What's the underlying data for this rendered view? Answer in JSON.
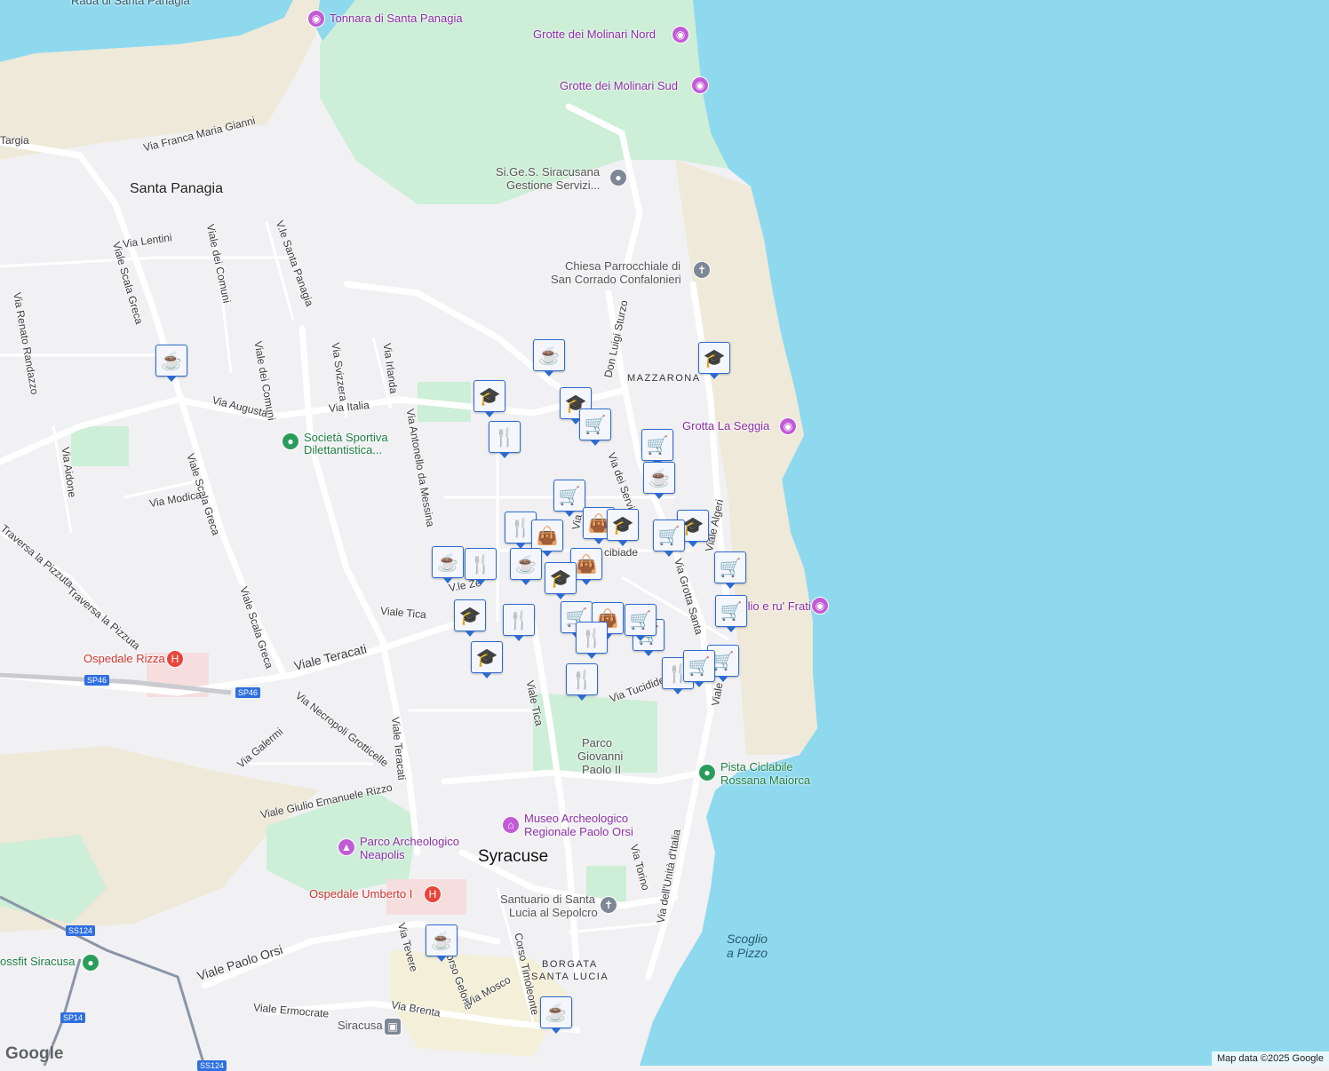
{
  "map": {
    "colors": {
      "water": "#8fd9ee",
      "land": "#f1f1f3",
      "park": "#cdeed7",
      "beige": "#efe9d9",
      "road": "#ffffff",
      "pin_border": "#2d6bd0",
      "pin_icon": "#0e2f5c"
    },
    "labels": {
      "rada": "Rada di Santa Panagia",
      "santa_panagia": "Santa Panagia",
      "mazzarona": "MAZZARONA",
      "syracuse": "Syracuse",
      "borgata1": "BORGATA",
      "borgata2": "SANTA LUCIA",
      "scoglio1": "Scoglio",
      "scoglio2": "a Pizzo"
    },
    "streets": {
      "targia": "Targia",
      "franca": "Via Franca Maria Gianni",
      "lentini": "Via Lentini",
      "comuni1": "Viale dei Comuni",
      "comuni2": "Viale dei Comuni",
      "santa_panagia": "V.le Santa Panagia",
      "scala_greca1": "Viale Scala Greca",
      "scala_greca2": "Viale Scala Greca",
      "scala_greca3": "Viale Scala Greca",
      "randazzo": "Via Renato Randazzo",
      "svizzera": "Via Svizzera",
      "irlanda": "Via Irlanda",
      "italia": "Via Italia",
      "augusta": "Via Augusta",
      "antonello": "Via Antonello da Messina",
      "aidone": "Via Aidone",
      "modica": "Via Modica",
      "pizzuta1": "Traversa la Pizzuta",
      "pizzuta2": "Traversa la Pizzuta",
      "tica1": "Viale Tica",
      "tica2": "Viale Tica",
      "teracati1": "Viale Teracati",
      "teracati2": "Viale Teracati",
      "necropoli": "Via Necropoli Grotticelle",
      "galermi": "Via Galermi",
      "rizzo": "Viale Giulio Emanuele Rizzo",
      "sturzo": "Don Luigi Sturzo",
      "servi": "Via dei Servi",
      "algeri": "Viale Algeri",
      "grotta": "Via Grotta Santa",
      "tucidide": "Via Tucidide",
      "unita": "Via dell'Unità d'Italia",
      "torino": "Via Torino",
      "tevere": "Via Tevere",
      "gelone": "Corso Gelone",
      "timoleonte": "Corso Timoleonte",
      "mosco": "Via Mosco",
      "brenta": "Via Brenta",
      "ermocrate": "Viale Ermocrate",
      "paolo_orsi": "Viale Paolo Orsi",
      "alcibiade": "cibiade",
      "zecchino": "V.le Ze",
      "filisto": "Via Fili",
      "viale": "Viale",
      "sp46a": "SP46",
      "sp46b": "SP46",
      "ss124": "SS124",
      "sp14": "SP14",
      "ss124b": "SS124"
    },
    "pois": {
      "tonnara": "Tonnara di Santa Panagia",
      "molinari_nord": "Grotte dei Molinari Nord",
      "molinari_sud": "Grotte dei Molinari Sud",
      "sigess1": "Si.Ge.S. Siracusana",
      "sigess2": "Gestione Servizi...",
      "chiesa1": "Chiesa Parrocchiale di",
      "chiesa2": "San Corrado Confalonieri",
      "seggia": "Grotta La Seggia",
      "societa1": "Società Sportiva",
      "societa2": "Dilettantistica...",
      "frati": "Scoglio e ru' Frati",
      "rizza": "Ospedale Rizza",
      "parco_gp1": "Parco",
      "parco_gp2": "Giovanni",
      "parco_gp3": "Paolo II",
      "pista1": "Pista Ciclabile",
      "pista2": "Rossana Maiorca",
      "museo1": "Museo Archeologico",
      "museo2": "Regionale Paolo Orsi",
      "neapolis1": "Parco Archeologico",
      "neapolis2": "Neapolis",
      "umberto": "Ospedale Umberto I",
      "santuario1": "Santuario di Santa",
      "santuario2": "Lucia al Sepolcro",
      "crossfit": "ossfit Siracusa",
      "station": "Siracusa"
    },
    "pins": [
      {
        "icon": "coffee-icon",
        "glyph": "☕"
      },
      {
        "icon": "coffee-icon",
        "glyph": "☕"
      },
      {
        "icon": "school-icon",
        "glyph": "🎓"
      },
      {
        "icon": "school-icon",
        "glyph": "🎓"
      },
      {
        "icon": "school-icon",
        "glyph": "🎓"
      },
      {
        "icon": "shopping-cart-icon",
        "glyph": "🛒"
      },
      {
        "icon": "restaurant-icon",
        "glyph": "🍴"
      },
      {
        "icon": "shopping-cart-icon",
        "glyph": "🛒"
      },
      {
        "icon": "coffee-icon",
        "glyph": "☕"
      },
      {
        "icon": "shopping-cart-icon",
        "glyph": "🛒"
      },
      {
        "icon": "restaurant-icon",
        "glyph": "🍴"
      },
      {
        "icon": "shopping-bag-icon",
        "glyph": "👜"
      },
      {
        "icon": "shopping-bag-icon",
        "glyph": "👜"
      },
      {
        "icon": "school-icon",
        "glyph": "🎓"
      },
      {
        "icon": "school-icon",
        "glyph": "🎓"
      },
      {
        "icon": "shopping-cart-icon",
        "glyph": "🛒"
      },
      {
        "icon": "coffee-icon",
        "glyph": "☕"
      },
      {
        "icon": "restaurant-icon",
        "glyph": "🍴"
      },
      {
        "icon": "coffee-icon",
        "glyph": "☕"
      },
      {
        "icon": "shopping-bag-icon",
        "glyph": "👜"
      },
      {
        "icon": "school-icon",
        "glyph": "🎓"
      },
      {
        "icon": "shopping-cart-icon",
        "glyph": "🛒"
      },
      {
        "icon": "shopping-cart-icon",
        "glyph": "🛒"
      },
      {
        "icon": "school-icon",
        "glyph": "🎓"
      },
      {
        "icon": "restaurant-icon",
        "glyph": "🍴"
      },
      {
        "icon": "school-icon",
        "glyph": "🎓"
      },
      {
        "icon": "shopping-cart-icon",
        "glyph": "🛒"
      },
      {
        "icon": "shopping-bag-icon",
        "glyph": "👜"
      },
      {
        "icon": "shopping-cart-icon",
        "glyph": "🛒"
      },
      {
        "icon": "restaurant-icon",
        "glyph": "🍴"
      },
      {
        "icon": "shopping-cart-icon",
        "glyph": "🛒"
      },
      {
        "icon": "restaurant-icon",
        "glyph": "🍴"
      },
      {
        "icon": "restaurant-icon",
        "glyph": "🍴"
      },
      {
        "icon": "shopping-cart-icon",
        "glyph": "🛒"
      },
      {
        "icon": "shopping-cart-icon",
        "glyph": "🛒"
      },
      {
        "icon": "coffee-icon",
        "glyph": "☕"
      },
      {
        "icon": "coffee-icon",
        "glyph": "☕"
      }
    ],
    "google_logo": "Google",
    "attribution": "Map data ©2025 Google"
  }
}
